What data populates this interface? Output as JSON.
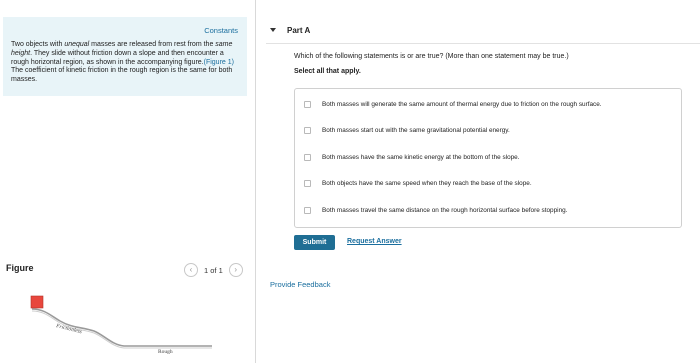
{
  "left_panel": {
    "constants_label": "Constants",
    "problem": {
      "part1": "Two objects with ",
      "em1": "unequal",
      "part2": " masses are released from rest from the ",
      "em2": "same height",
      "part3": ". They slide without friction down a slope and then encounter a rough horizontal region, as shown in the accompanying figure.",
      "figure_link": "(Figure 1)",
      "part4": " The coefficient of kinetic friction in the rough region is the same for both masses."
    },
    "figure": {
      "title": "Figure",
      "pager_text": "1 of 1",
      "prev_glyph": "‹",
      "next_glyph": "›",
      "label_frictionless": "Frictionless",
      "label_rough": "Rough",
      "colors": {
        "block": "#e8473d",
        "surface": "#9a9a9a"
      }
    }
  },
  "part": {
    "title": "Part A",
    "question": "Which of the following statements is or are true? (More than one statement may be true.)",
    "instruction": "Select all that apply.",
    "options": [
      {
        "label": "Both masses will generate the same amount of thermal energy due to friction on the rough surface.",
        "checked": false
      },
      {
        "label": "Both masses start out with the same gravitational potential energy.",
        "checked": false
      },
      {
        "label": "Both masses have the same kinetic energy at the bottom of the slope.",
        "checked": false
      },
      {
        "label": "Both objects have the same speed when they reach the base of the slope.",
        "checked": false
      },
      {
        "label": "Both masses travel the same distance on the rough horizontal surface before stopping.",
        "checked": false
      }
    ],
    "submit_label": "Submit",
    "request_answer_label": "Request Answer"
  },
  "feedback_label": "Provide Feedback",
  "colors": {
    "accent": "#1f6e94",
    "link": "#1a6e9e",
    "constants_bg": "#e8f4f8"
  }
}
